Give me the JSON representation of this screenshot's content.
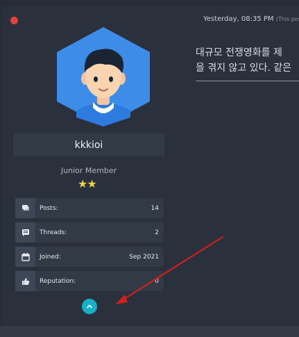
{
  "post": {
    "timestamp": "Yesterday, 08:35 PM",
    "timestamp_suffix": "(This post",
    "text_line1": "대규모 전쟁영화를 제",
    "text_line2": "을 겪지 않고 있다. 같은"
  },
  "user": {
    "name": "kkkioi",
    "rank": "Junior Member",
    "stars": "★★",
    "stats": [
      {
        "label": "Posts:",
        "value": "14",
        "icon": "posts-icon"
      },
      {
        "label": "Threads:",
        "value": "2",
        "icon": "threads-icon"
      },
      {
        "label": "Joined:",
        "value": "Sep 2021",
        "icon": "calendar-icon"
      },
      {
        "label": "Reputation:",
        "value": "0",
        "icon": "thumbs-up-icon"
      }
    ]
  },
  "colors": {
    "background": "#262d38",
    "panel": "#2a313c",
    "accent": "#16b1c9",
    "avatar_hex": "#3d8de8",
    "close_red": "#e5413a",
    "arrow_red": "#d01f1f"
  }
}
